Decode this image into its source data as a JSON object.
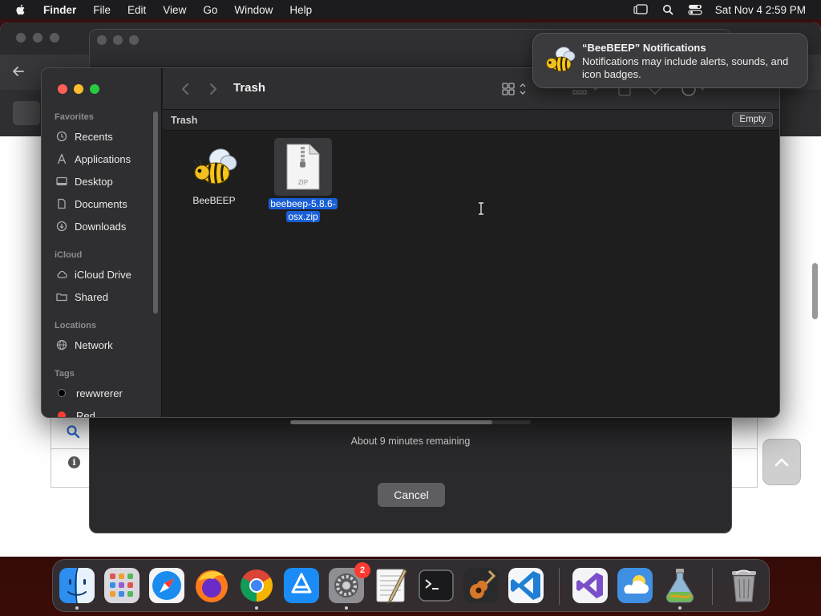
{
  "menubar": {
    "app_name": "Finder",
    "items": [
      "File",
      "Edit",
      "View",
      "Go",
      "Window",
      "Help"
    ],
    "clock": "Sat Nov 4  2:59 PM"
  },
  "notification": {
    "title": "“BeeBEEP” Notifications",
    "body": "Notifications may include alerts, sounds, and icon badges."
  },
  "installer": {
    "remaining": "About 9 minutes remaining",
    "cancel_label": "Cancel",
    "progress": 0.84
  },
  "finder": {
    "title": "Trash",
    "path_label": "Trash",
    "empty_label": "Empty",
    "sidebar": {
      "favorites_header": "Favorites",
      "favorites": [
        "Recents",
        "Applications",
        "Desktop",
        "Documents",
        "Downloads"
      ],
      "icloud_header": "iCloud",
      "icloud": [
        "iCloud Drive",
        "Shared"
      ],
      "locations_header": "Locations",
      "locations": [
        "Network"
      ],
      "tags_header": "Tags",
      "tags": [
        "rewwrerer",
        "Red"
      ]
    },
    "files": [
      {
        "name": "BeeBEEP",
        "kind": "app"
      },
      {
        "name": "beebeep-5.8.6-osx.zip",
        "name_line1": "beebeep-5.8.6-",
        "name_line2": "osx.zip",
        "kind": "zip",
        "badge": "ZIP"
      }
    ]
  },
  "dock": {
    "apps": [
      "Finder",
      "Launchpad",
      "Safari",
      "Firefox",
      "Chrome",
      "App Store",
      "System Settings",
      "TextEdit",
      "Terminal",
      "GarageBand",
      "Visual Studio Code",
      "Visual Studio",
      "Weather",
      "Image Tool",
      "Trash"
    ],
    "settings_badge": "2"
  },
  "colors": {
    "selection": "#1a5fd6",
    "close": "#ff5f57",
    "minimize": "#febc2e",
    "zoom": "#28c840",
    "badge": "#ff3b30"
  }
}
